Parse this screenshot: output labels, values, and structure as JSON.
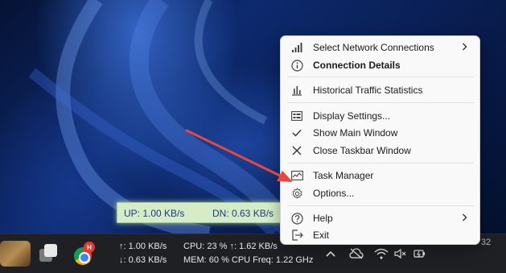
{
  "traffic_window": {
    "up": "UP: 1.00 KB/s",
    "dn": "DN: 0.63 KB/s"
  },
  "taskbar": {
    "chrome_badge": "H",
    "net": {
      "up": "↑: 1.00 KB/s",
      "dn": "↓: 0.63 KB/s"
    },
    "sys": {
      "line1": "CPU: 23 %  ↑: 1.62 KB/s",
      "line2": "MEM: 60 % CPU Freq: 1.22 GHz"
    },
    "clock_partial": "32"
  },
  "menu": {
    "select_network": "Select Network Connections",
    "connection_details": "Connection Details",
    "historical_traffic": "Historical Traffic Statistics",
    "display_settings": "Display Settings...",
    "show_main_window": "Show Main Window",
    "close_taskbar_window": "Close Taskbar Window",
    "task_manager": "Task Manager",
    "options": "Options...",
    "help": "Help",
    "exit": "Exit"
  },
  "colors": {
    "annotation_arrow": "#e8483a",
    "traffic_bg": "#d6ecc6",
    "traffic_text": "#1a3a8a"
  }
}
